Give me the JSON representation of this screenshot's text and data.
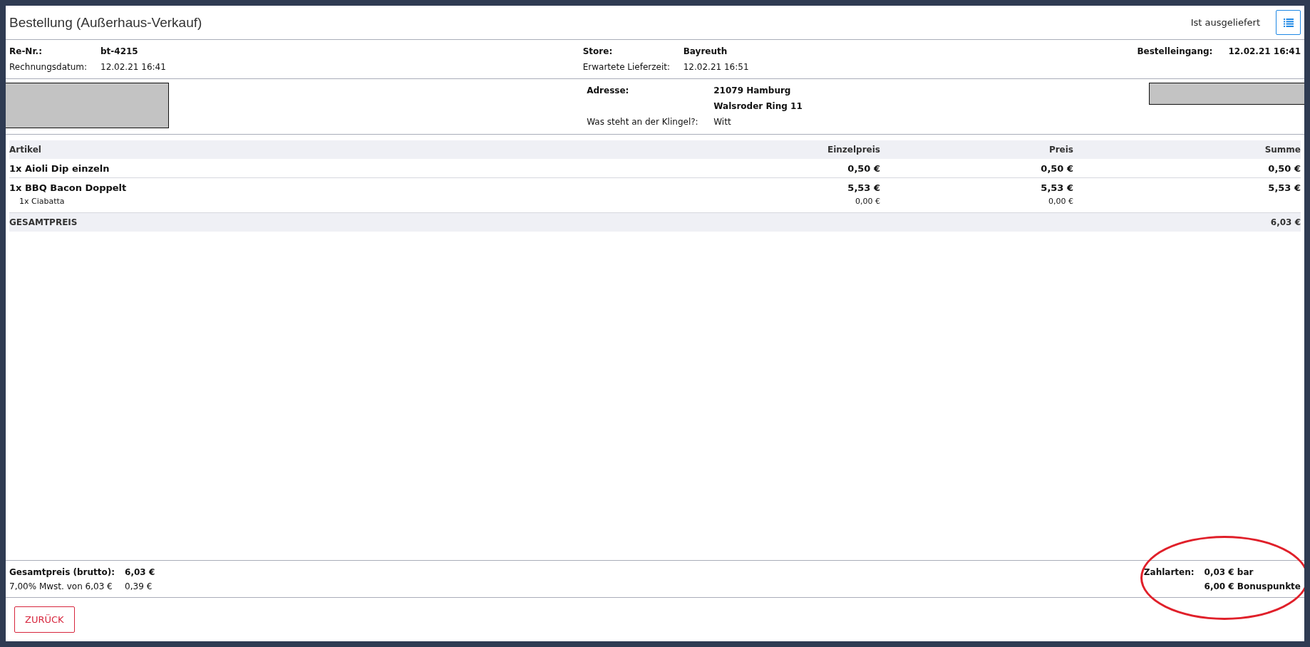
{
  "header": {
    "title": "Bestellung (Außerhaus-Verkauf)",
    "status": "Ist ausgeliefert"
  },
  "info": [
    {
      "rows": [
        {
          "kind": "primary",
          "label": "Re-Nr.:",
          "value": "bt-4215"
        },
        {
          "kind": "secondary",
          "label": "Rechnungsdatum:",
          "value": "12.02.21 16:41"
        }
      ]
    },
    {
      "rows": [
        {
          "kind": "primary",
          "label": "Store:",
          "value": "Bayreuth"
        },
        {
          "kind": "secondary",
          "label": "Erwartete Lieferzeit:",
          "value": "12.02.21 16:51"
        }
      ]
    },
    {
      "rows": [
        {
          "kind": "primary",
          "label": "Bestelleingang:",
          "value": "12.02.21 16:41"
        }
      ]
    }
  ],
  "address": [
    {
      "kind": "primary",
      "label": "Adresse:",
      "value": "21079 Hamburg"
    },
    {
      "kind": "primary",
      "value": "Walsroder Ring 11"
    },
    {
      "kind": "secondary",
      "label": "Was steht an der Klingel?:",
      "value": "Witt"
    }
  ],
  "table": {
    "columns": [
      "Artikel",
      "Einzelpreis",
      "Preis",
      "Summe"
    ],
    "rows": [
      {
        "kind": "item",
        "cells": [
          "1x Aioli Dip einzeln",
          "0,50 €",
          "0,50 €",
          "0,50 €"
        ]
      },
      {
        "kind": "item",
        "cells": [
          "1x BBQ Bacon Doppelt",
          "5,53 €",
          "5,53 €",
          "5,53 €"
        ]
      },
      {
        "kind": "sub",
        "cells": [
          "1x Ciabatta",
          "0,00 €",
          "0,00 €",
          ""
        ]
      },
      {
        "kind": "total",
        "cells": [
          "GESAMTPREIS",
          "",
          "",
          "6,03 €"
        ]
      }
    ]
  },
  "totals": [
    {
      "kind": "primary",
      "label": "Gesamtpreis (brutto):",
      "value": "6,03 €"
    },
    {
      "kind": "secondary",
      "label": "7,00% Mwst. von 6,03 €",
      "value": "0,39 €"
    }
  ],
  "payments": {
    "label": "Zahlarten:",
    "lines": [
      "0,03 € bar",
      "6,00 € Bonuspunkte"
    ]
  },
  "back_button": "ZURÜCK"
}
